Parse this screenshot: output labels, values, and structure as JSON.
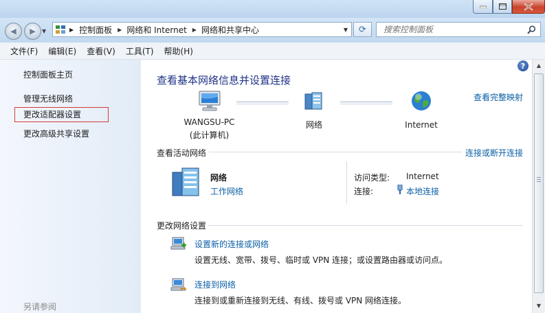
{
  "addressbar": {
    "crumbs": [
      "控制面板",
      "网络和 Internet",
      "网络和共享中心"
    ],
    "search_placeholder": "搜索控制面板"
  },
  "menu": [
    "文件(F)",
    "编辑(E)",
    "查看(V)",
    "工具(T)",
    "帮助(H)"
  ],
  "sidebar": {
    "home": "控制面板主页",
    "items": [
      "管理无线网络",
      "更改适配器设置",
      "更改高级共享设置"
    ],
    "see_also": "另请参阅"
  },
  "main": {
    "title": "查看基本网络信息并设置连接",
    "full_map_link": "查看完整映射",
    "map": {
      "computer_name": "WANGSU-PC",
      "computer_sub": "(此计算机)",
      "network": "网络",
      "internet": "Internet"
    },
    "active_header": "查看活动网络",
    "connect_link": "连接或断开连接",
    "active": {
      "name": "网络",
      "type_link": "工作网络",
      "access_label": "访问类型:",
      "access_value": "Internet",
      "conn_label": "连接:",
      "conn_value": "本地连接"
    },
    "change_header": "更改网络设置",
    "tasks": [
      {
        "link": "设置新的连接或网络",
        "desc": "设置无线、宽带、拨号、临时或 VPN 连接；或设置路由器或访问点。"
      },
      {
        "link": "连接到网络",
        "desc": "连接到或重新连接到无线、有线、拨号或 VPN 网络连接。"
      }
    ]
  }
}
